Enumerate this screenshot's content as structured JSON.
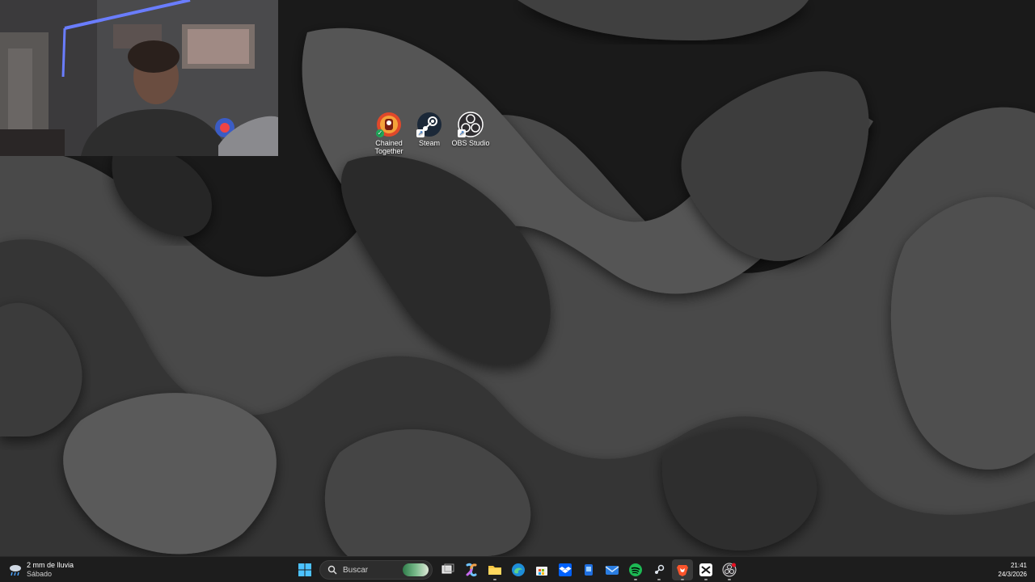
{
  "desktop": {
    "icons": [
      {
        "label_line1": "Chained",
        "label_line2": "Together",
        "icon": "chained-together-app-icon"
      },
      {
        "label": "Steam",
        "icon": "steam-icon"
      },
      {
        "label": "OBS Studio",
        "icon": "obs-studio-icon"
      }
    ]
  },
  "taskbar": {
    "weather": {
      "line1": "2 mm de lluvia",
      "line2": "Sábado",
      "icon": "rain-cloud-icon"
    },
    "search": {
      "placeholder": "Buscar"
    },
    "pinned": [
      {
        "name": "start",
        "icon": "windows-logo-icon"
      },
      {
        "name": "task-view",
        "icon": "task-view-icon"
      },
      {
        "name": "copilot",
        "icon": "copilot-icon"
      },
      {
        "name": "file-explorer",
        "icon": "folder-icon"
      },
      {
        "name": "edge",
        "icon": "edge-icon"
      },
      {
        "name": "store",
        "icon": "store-icon"
      },
      {
        "name": "dropbox",
        "icon": "dropbox-icon"
      },
      {
        "name": "app-blue",
        "icon": "app-icon"
      },
      {
        "name": "mail",
        "icon": "mail-icon"
      },
      {
        "name": "spotify",
        "icon": "spotify-icon"
      },
      {
        "name": "steam",
        "icon": "steam-icon"
      },
      {
        "name": "brave",
        "icon": "brave-icon"
      },
      {
        "name": "capcut",
        "icon": "capcut-icon"
      },
      {
        "name": "obs",
        "icon": "obs-studio-icon"
      }
    ],
    "clock": {
      "time": "21:41",
      "date": "24/3/2026"
    }
  },
  "colors": {
    "taskbar_bg": "#1d1d1d",
    "wallpaper_base": "#2b2b2b",
    "accent_blue": "#3c8ce7"
  }
}
